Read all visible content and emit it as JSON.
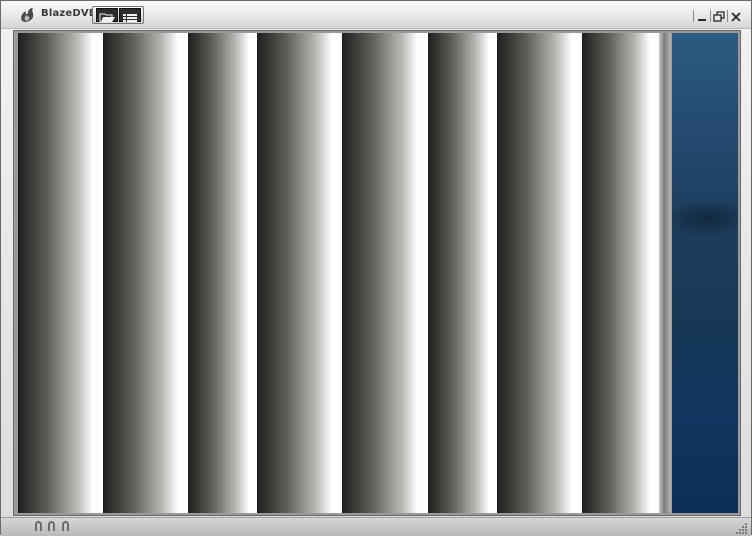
{
  "window": {
    "app_name": "BlazeDVD"
  },
  "toolbar": {
    "buttons": [
      {
        "icon": "open-folder-icon"
      },
      {
        "icon": "playlist-icon"
      }
    ]
  },
  "window_controls": {
    "icons": [
      "minimize-icon",
      "restore-icon",
      "close-icon"
    ]
  },
  "video": {
    "stripe_widths": [
      85,
      85,
      69,
      85,
      86,
      69,
      85,
      77
    ]
  },
  "statusbar": {
    "indicators": 3
  },
  "colors": {
    "chrome_light": "#f2f2f2",
    "chrome_dark": "#b9b9b9",
    "desktop_blue": "#1c3c5c",
    "stripe_dark": "#1d1f1c",
    "stripe_light": "#ffffff"
  }
}
